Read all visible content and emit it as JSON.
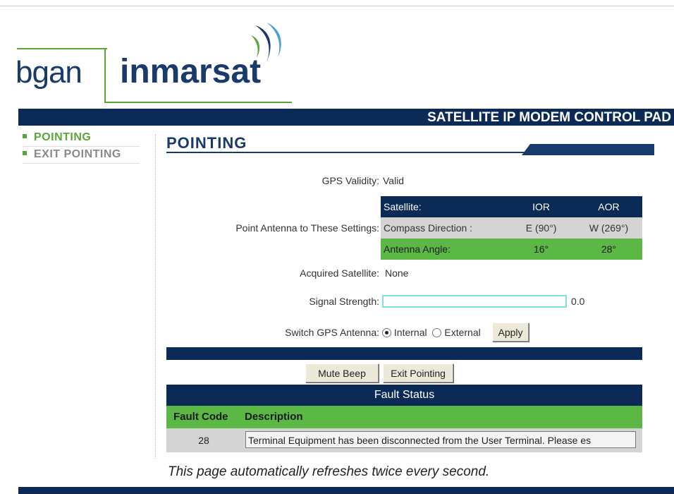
{
  "logo": {
    "left_text": "bgan",
    "right_text": "inmarsat"
  },
  "header": {
    "title": "SATELLITE IP MODEM CONTROL PAD"
  },
  "sidebar": {
    "items": [
      {
        "label": "POINTING",
        "active": true
      },
      {
        "label": "EXIT POINTING",
        "active": false
      }
    ]
  },
  "page": {
    "title": "POINTING"
  },
  "gps": {
    "label": "GPS Validity:",
    "value": "Valid"
  },
  "pointing": {
    "label": "Point Antenna to These Settings:",
    "table": {
      "header": [
        "Satellite:",
        "IOR",
        "AOR"
      ],
      "compass": [
        "Compass Direction :",
        "E (90°)",
        "W (269°)"
      ],
      "angle": [
        "Antenna Angle:",
        "16°",
        "28°"
      ]
    }
  },
  "acquired": {
    "label": "Acquired Satellite:",
    "value": "None"
  },
  "signal": {
    "label": "Signal Strength:",
    "value": "0.0",
    "level_fraction": 0.0
  },
  "gps_antenna": {
    "label": "Switch GPS Antenna:",
    "options": [
      "Internal",
      "External"
    ],
    "selected": "Internal",
    "apply_label": "Apply"
  },
  "actions": {
    "mute_label": "Mute Beep",
    "exit_label": "Exit Pointing"
  },
  "fault": {
    "title": "Fault Status",
    "col_code": "Fault Code",
    "col_desc": "Description",
    "rows": [
      {
        "code": "28",
        "description": "Terminal Equipment has been disconnected from the User Terminal.  Please es"
      }
    ]
  },
  "footer": {
    "note": "This page automatically refreshes twice every second."
  },
  "colors": {
    "navy": "#0c2a56",
    "green": "#5cb845",
    "logo_green": "#5aa63a",
    "signal_border": "#7fdede"
  }
}
